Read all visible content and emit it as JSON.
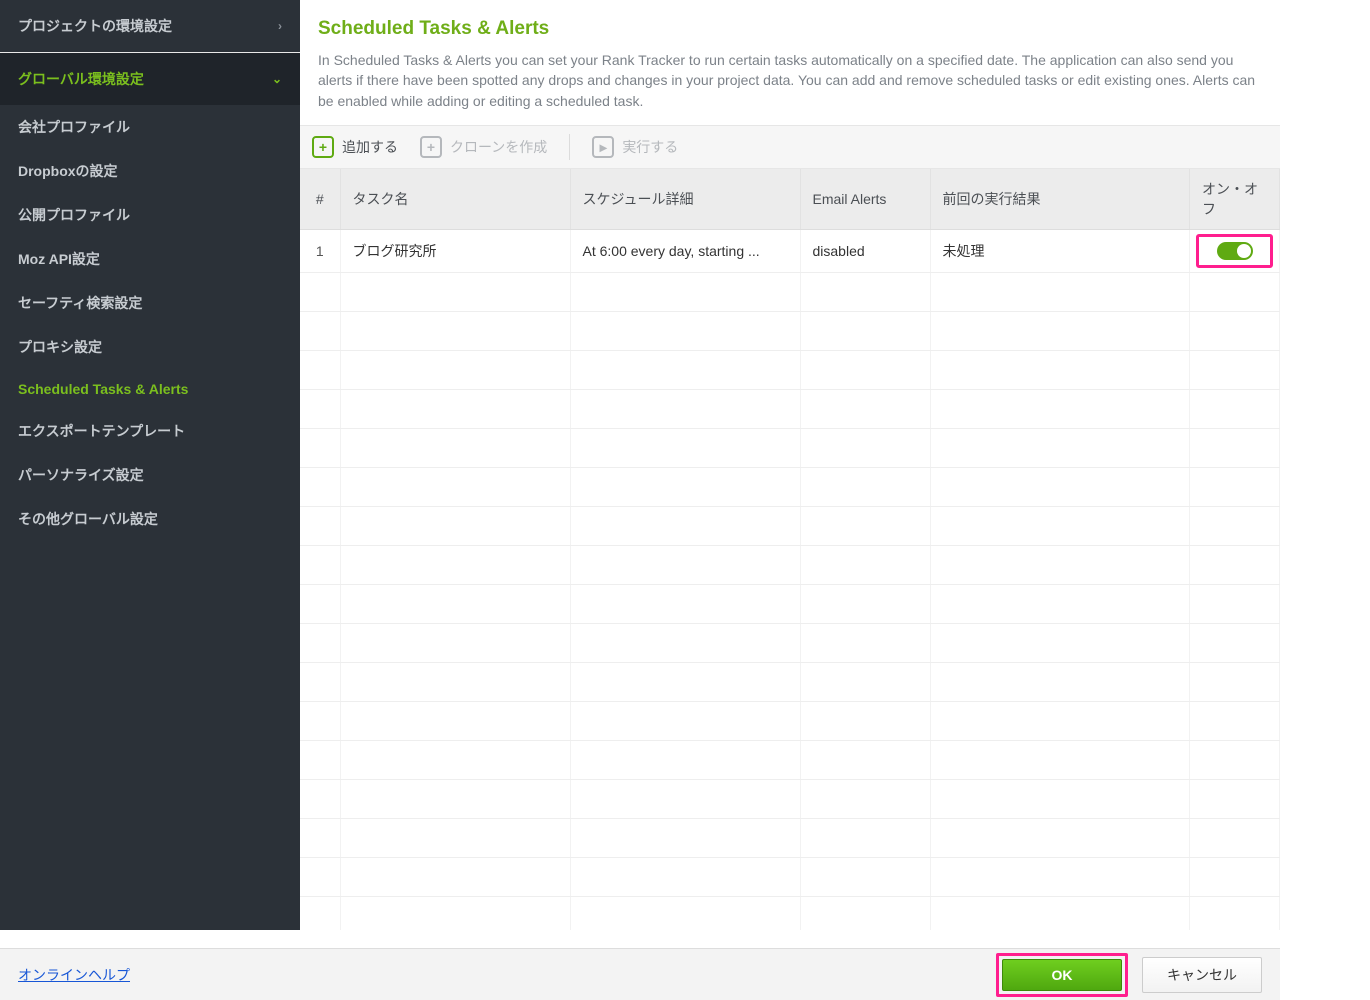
{
  "sidebar": {
    "sections": [
      {
        "label": "プロジェクトの環境設定",
        "active": false,
        "chev": "›"
      },
      {
        "label": "グローバル環境設定",
        "active": true,
        "chev": "⌄"
      }
    ],
    "items": [
      {
        "label": "会社プロファイル",
        "selected": false
      },
      {
        "label": "Dropboxの設定",
        "selected": false
      },
      {
        "label": "公開プロファイル",
        "selected": false
      },
      {
        "label": "Moz API設定",
        "selected": false
      },
      {
        "label": "セーフティ検索設定",
        "selected": false
      },
      {
        "label": "プロキシ設定",
        "selected": false
      },
      {
        "label": "Scheduled Tasks & Alerts",
        "selected": true
      },
      {
        "label": "エクスポートテンプレート",
        "selected": false
      },
      {
        "label": "パーソナライズ設定",
        "selected": false
      },
      {
        "label": "その他グローバル設定",
        "selected": false
      }
    ]
  },
  "header": {
    "title": "Scheduled Tasks & Alerts",
    "description": "In Scheduled Tasks & Alerts you can set your Rank Tracker to run certain tasks automatically on a specified date. The application can also send you alerts if there have been spotted any drops and changes in your project data. You can add and remove scheduled tasks or edit existing ones. Alerts can be enabled while adding or editing a scheduled task."
  },
  "toolbar": {
    "add": "追加する",
    "clone": "クローンを作成",
    "run": "実行する"
  },
  "table": {
    "columns": {
      "num": "#",
      "name": "タスク名",
      "schedule": "スケジュール詳細",
      "alerts": "Email Alerts",
      "result": "前回の実行結果",
      "onoff": "オン・オフ"
    },
    "rows": [
      {
        "num": "1",
        "name": "ブログ研究所",
        "schedule": "At 6:00 every day, starting ...",
        "alerts": "disabled",
        "result": "未処理",
        "on": true
      }
    ],
    "empty_rows": 17
  },
  "footer": {
    "help": "オンラインヘルプ",
    "ok": "OK",
    "cancel": "キャンセル"
  }
}
